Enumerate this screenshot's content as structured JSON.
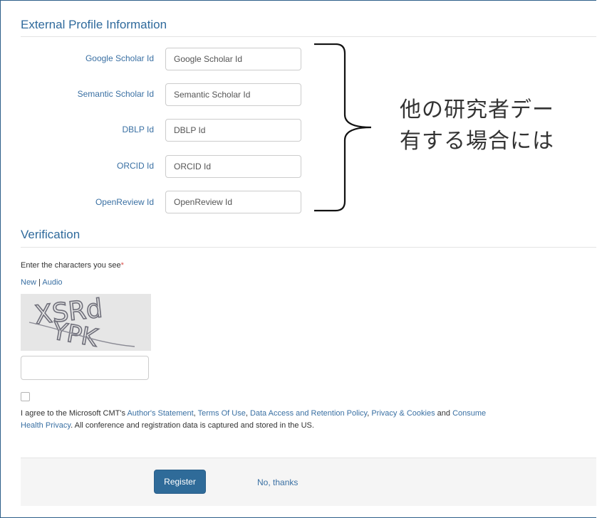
{
  "external_profile": {
    "title": "External Profile Information",
    "fields": [
      {
        "label": "Google Scholar Id",
        "placeholder": "Google Scholar Id",
        "value": ""
      },
      {
        "label": "Semantic Scholar Id",
        "placeholder": "Semantic Scholar Id",
        "value": ""
      },
      {
        "label": "DBLP Id",
        "placeholder": "DBLP Id",
        "value": ""
      },
      {
        "label": "ORCID Id",
        "placeholder": "ORCID Id",
        "value": ""
      },
      {
        "label": "OpenReview Id",
        "placeholder": "OpenReview Id",
        "value": ""
      }
    ]
  },
  "annotation": {
    "line1": "他の研究者デー",
    "line2": "有する場合には"
  },
  "verification": {
    "title": "Verification",
    "prompt": "Enter the characters you see",
    "required_mark": "*",
    "new_link": "New",
    "separator": " | ",
    "audio_link": "Audio",
    "captcha_line1": "XSRd",
    "captcha_line2": "YPK",
    "captcha_value": ""
  },
  "agreement": {
    "checked": false,
    "prefix": "I agree to the Microsoft CMT's ",
    "authors_statement": "Author's Statement",
    "comma1": ", ",
    "terms_of_use": "Terms Of Use",
    "comma2": ", ",
    "data_access": "Data Access and Retention Policy",
    "comma3": ", ",
    "privacy": "Privacy & Cookies",
    "and": " and ",
    "consumer_health_1": "Consume",
    "consumer_health_2": "Health Privacy",
    "suffix": ". All conference and registration data is captured and stored in the US."
  },
  "footer": {
    "register_label": "Register",
    "no_thanks_label": "No, thanks"
  },
  "colors": {
    "link": "#3a70a3",
    "primary_button": "#2f6b99",
    "section_title": "#2f6a9c",
    "required": "#d9534f"
  }
}
